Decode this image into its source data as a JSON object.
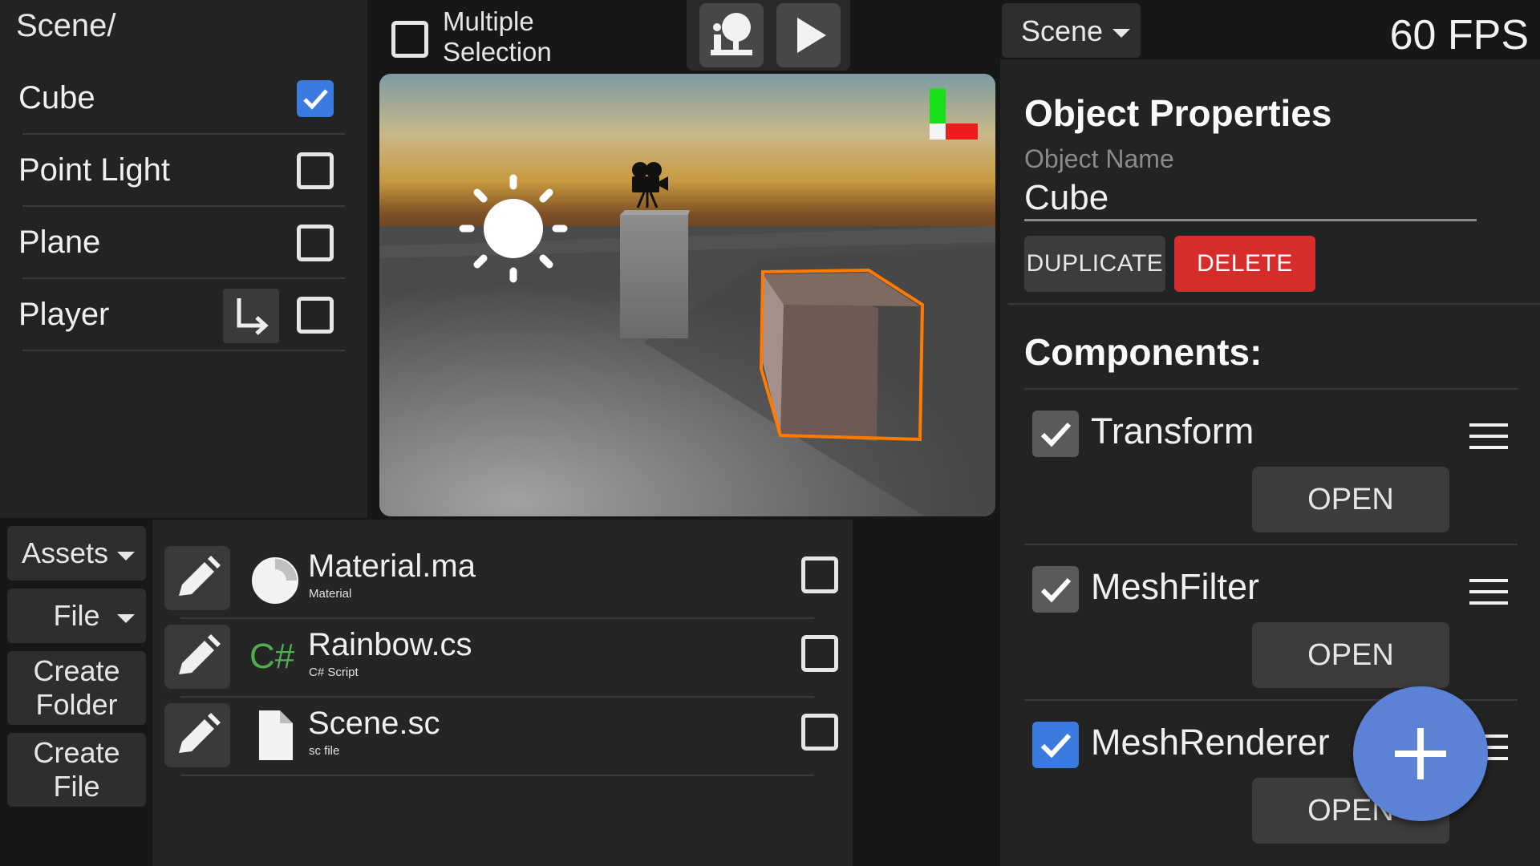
{
  "hierarchy": {
    "path": "Scene/",
    "items": [
      {
        "label": "Cube",
        "checked": true
      },
      {
        "label": "Point Light",
        "checked": false
      },
      {
        "label": "Plane",
        "checked": false
      },
      {
        "label": "Player",
        "checked": false,
        "child_icon": "child-arrow-icon"
      }
    ]
  },
  "toolbar": {
    "multiple_selection_label": "Multiple Selection",
    "multiple_selection_checked": false,
    "tools": [
      "scene-tool-icon",
      "play-icon"
    ]
  },
  "viewport": {
    "gizmos": [
      "sun-icon",
      "camera-icon",
      "axis-gizmo"
    ],
    "selected_object": "Cube",
    "selection_color": "#ff7a00"
  },
  "assets": {
    "dropdown_label": "Assets",
    "file_dropdown_label": "File",
    "create_folder_label": "Create Folder",
    "create_file_label": "Create File",
    "items": [
      {
        "name": "Material.ma",
        "type": "Material",
        "icon": "material-icon",
        "checked": false
      },
      {
        "name": "Rainbow.cs",
        "type": "C# Script",
        "icon": "csharp-icon",
        "icon_text": "C#",
        "checked": false
      },
      {
        "name": "Scene.sc",
        "type": "sc file",
        "icon": "file-icon",
        "checked": false
      }
    ]
  },
  "header": {
    "scene_dropdown": "Scene",
    "fps": "60 FPS"
  },
  "inspector": {
    "title": "Object Properties",
    "object_name_label": "Object Name",
    "object_name_value": "Cube",
    "duplicate_label": "DUPLICATE",
    "delete_label": "DELETE",
    "components_title": "Components:",
    "components": [
      {
        "name": "Transform",
        "enabled": true,
        "open_label": "OPEN"
      },
      {
        "name": "MeshFilter",
        "enabled": true,
        "open_label": "OPEN"
      },
      {
        "name": "MeshRenderer",
        "enabled": true,
        "open_label": "OPEN"
      }
    ]
  },
  "fab_icon": "plus-icon",
  "colors": {
    "accent": "#3b7be0",
    "danger": "#d62c2c",
    "fab": "#5b82d4",
    "checkbox_gray": "#5a5a5a"
  }
}
